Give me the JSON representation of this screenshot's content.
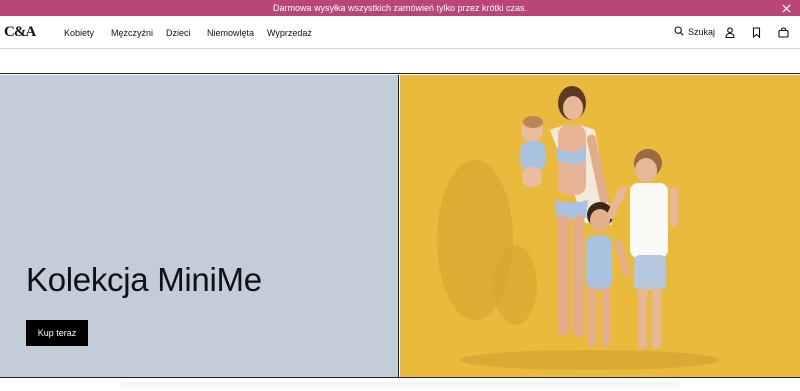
{
  "promo": {
    "text": "Darmowa wysyłka wszystkich zamówień tylko przez krótki czas.",
    "close_icon": "close-icon"
  },
  "header": {
    "logo_text": "C&A",
    "nav": [
      {
        "label": "Kobiety"
      },
      {
        "label": "Mężczyźni"
      },
      {
        "label": "Dzieci"
      },
      {
        "label": "Niemowlęta"
      },
      {
        "label": "Wyprzedaż"
      }
    ],
    "search_label": "Szukaj",
    "icons": [
      "search-icon",
      "account-icon",
      "wishlist-icon",
      "cart-icon"
    ]
  },
  "hero": {
    "title": "Kolekcja MiniMe",
    "cta_label": "Kup teraz",
    "left_bg": "#c3cdda",
    "right_bg": "#e9ba3c"
  },
  "colors": {
    "promo_bg": "#b94677",
    "cta_bg": "#000000"
  }
}
